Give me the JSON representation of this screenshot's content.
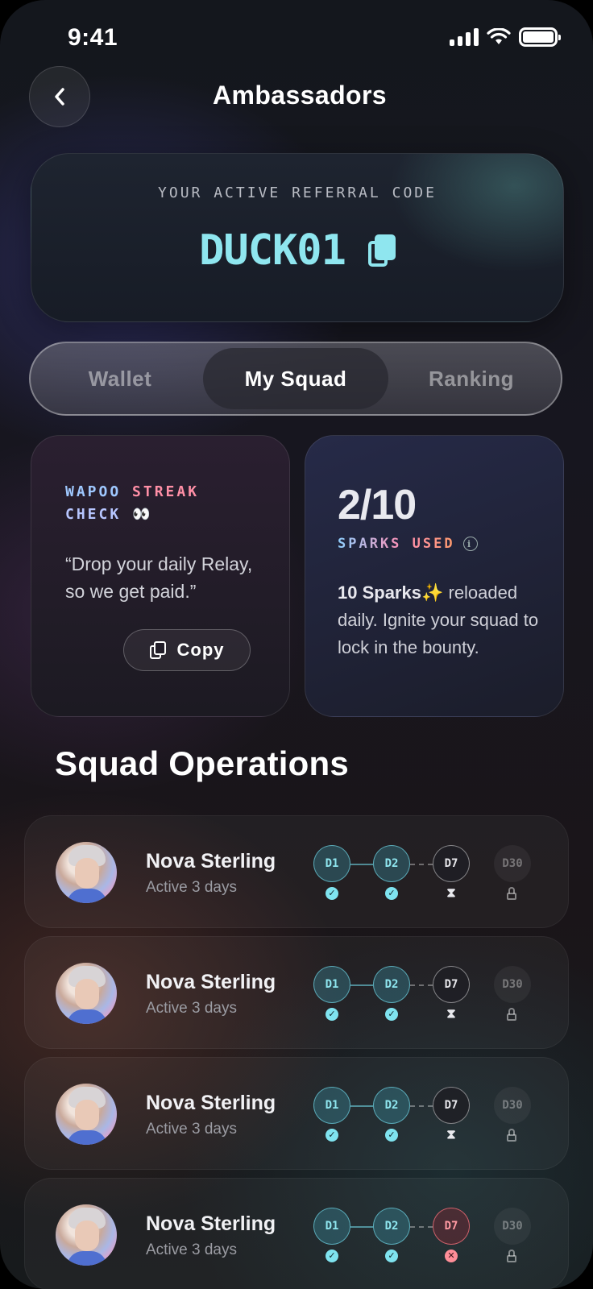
{
  "status_bar": {
    "time": "9:41"
  },
  "header": {
    "title": "Ambassadors"
  },
  "referral": {
    "label": "YOUR ACTIVE REFERRAL CODE",
    "code": "DUCK01"
  },
  "tabs": [
    {
      "label": "Wallet",
      "active": false
    },
    {
      "label": "My Squad",
      "active": true
    },
    {
      "label": "Ranking",
      "active": false
    }
  ],
  "streak_card": {
    "title_word1": "WAPOO",
    "title_word2": "STREAK",
    "title_word3": "CHECK",
    "emoji": "👀",
    "quote": "“Drop your daily Relay, so we get paid.”",
    "copy_label": "Copy"
  },
  "sparks_card": {
    "count": "2/10",
    "label": "SPARKS USED",
    "desc_bold": "10 Sparks",
    "desc_sparkle": "✨",
    "desc_rest": " reloaded daily. Ignite your squad to lock in the bounty."
  },
  "section": {
    "title": "Squad Operations"
  },
  "operations": [
    {
      "name": "Nova Sterling",
      "status": "Active 3 days",
      "days": [
        {
          "label": "D1",
          "state": "done"
        },
        {
          "label": "D2",
          "state": "done"
        },
        {
          "label": "D7",
          "state": "wait"
        },
        {
          "label": "D30",
          "state": "locked"
        }
      ]
    },
    {
      "name": "Nova Sterling",
      "status": "Active 3 days",
      "days": [
        {
          "label": "D1",
          "state": "done"
        },
        {
          "label": "D2",
          "state": "done"
        },
        {
          "label": "D7",
          "state": "wait"
        },
        {
          "label": "D30",
          "state": "locked"
        }
      ]
    },
    {
      "name": "Nova Sterling",
      "status": "Active 3 days",
      "days": [
        {
          "label": "D1",
          "state": "done"
        },
        {
          "label": "D2",
          "state": "done"
        },
        {
          "label": "D7",
          "state": "wait"
        },
        {
          "label": "D30",
          "state": "locked"
        }
      ]
    },
    {
      "name": "Nova Sterling",
      "status": "Active 3 days",
      "days": [
        {
          "label": "D1",
          "state": "done"
        },
        {
          "label": "D2",
          "state": "done"
        },
        {
          "label": "D7",
          "state": "fail"
        },
        {
          "label": "D30",
          "state": "locked"
        }
      ]
    }
  ],
  "colors": {
    "accent": "#8fe6ef",
    "fail": "#ff8e98",
    "streak_pink": "#ff8fa6",
    "streak_blue": "#9fc8ff"
  }
}
